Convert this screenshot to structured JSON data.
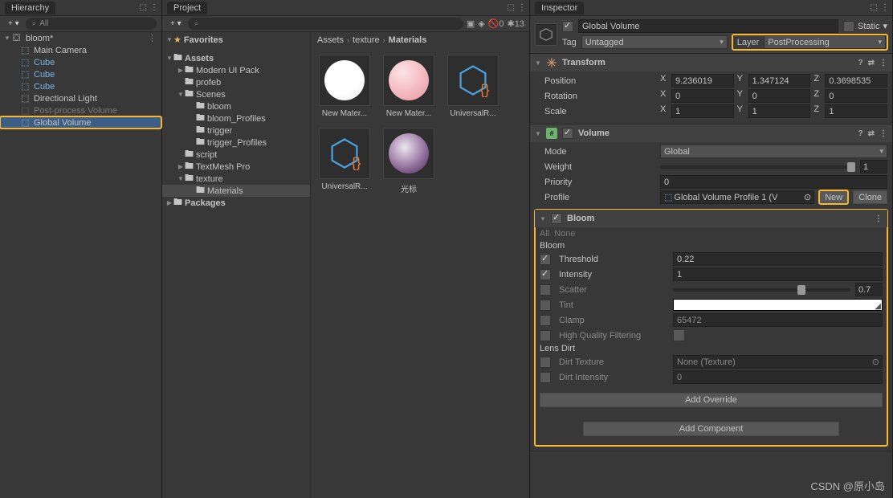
{
  "hierarchy": {
    "title": "Hierarchy",
    "search": "All",
    "scene": "bloom*",
    "items": [
      "Main Camera",
      "Cube",
      "Cube",
      "Cube",
      "Directional Light",
      "Post-process Volume",
      "Global Volume"
    ]
  },
  "project": {
    "title": "Project",
    "stats_hidden": "0",
    "stats_layers": "13",
    "favorites": "Favorites",
    "tree": [
      {
        "name": "Assets",
        "depth": 0,
        "fold": "▼"
      },
      {
        "name": "Modern UI Pack",
        "depth": 1,
        "fold": "▶"
      },
      {
        "name": "profeb",
        "depth": 1
      },
      {
        "name": "Scenes",
        "depth": 1,
        "fold": "▼"
      },
      {
        "name": "bloom",
        "depth": 2
      },
      {
        "name": "bloom_Profiles",
        "depth": 2
      },
      {
        "name": "trigger",
        "depth": 2
      },
      {
        "name": "trigger_Profiles",
        "depth": 2
      },
      {
        "name": "script",
        "depth": 1
      },
      {
        "name": "TextMesh Pro",
        "depth": 1,
        "fold": "▶"
      },
      {
        "name": "texture",
        "depth": 1,
        "fold": "▼"
      },
      {
        "name": "Materials",
        "depth": 2,
        "sel": true
      },
      {
        "name": "Packages",
        "depth": 0,
        "fold": "▶"
      }
    ],
    "breadcrumb": [
      "Assets",
      "texture",
      "Materials"
    ],
    "assets": [
      "New Mater...",
      "New Mater...",
      "UniversalR...",
      "UniversalR...",
      "光标"
    ]
  },
  "inspector": {
    "title": "Inspector",
    "name": "Global Volume",
    "static": "Static",
    "tag_label": "Tag",
    "tag": "Untagged",
    "layer_label": "Layer",
    "layer": "PostProcessing",
    "transform": {
      "title": "Transform",
      "position": {
        "label": "Position",
        "x": "9.236019",
        "y": "1.347124",
        "z": "0.3698535"
      },
      "rotation": {
        "label": "Rotation",
        "x": "0",
        "y": "0",
        "z": "0"
      },
      "scale": {
        "label": "Scale",
        "x": "1",
        "y": "1",
        "z": "1"
      }
    },
    "volume": {
      "title": "Volume",
      "mode": {
        "label": "Mode",
        "value": "Global"
      },
      "weight": {
        "label": "Weight",
        "value": "1"
      },
      "priority": {
        "label": "Priority",
        "value": "0"
      },
      "profile": {
        "label": "Profile",
        "value": "Global Volume Profile 1 (V",
        "new": "New",
        "clone": "Clone"
      }
    },
    "bloom": {
      "title": "Bloom",
      "all": "All",
      "none": "None",
      "section1": "Bloom",
      "threshold": {
        "label": "Threshold",
        "value": "0.22",
        "on": true
      },
      "intensity": {
        "label": "Intensity",
        "value": "1",
        "on": true
      },
      "scatter": {
        "label": "Scatter",
        "value": "0.7"
      },
      "tint": {
        "label": "Tint"
      },
      "clamp": {
        "label": "Clamp",
        "value": "65472"
      },
      "hq": {
        "label": "High Quality Filtering"
      },
      "section2": "Lens Dirt",
      "dirt_tex": {
        "label": "Dirt Texture",
        "value": "None (Texture)"
      },
      "dirt_int": {
        "label": "Dirt Intensity",
        "value": "0"
      },
      "add_override": "Add Override"
    },
    "add_component": "Add Component"
  },
  "watermark": "CSDN @原小岛"
}
